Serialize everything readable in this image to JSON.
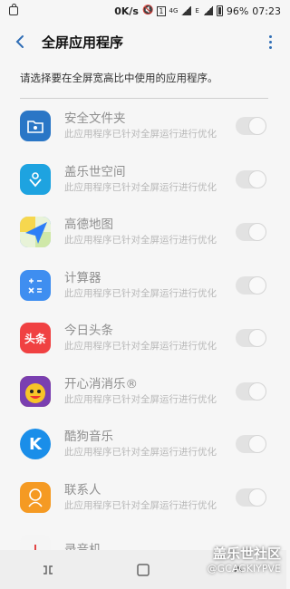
{
  "status_bar": {
    "network_speed": "0K/s",
    "network_type": "4G",
    "battery": "96%",
    "time": "07:23"
  },
  "header": {
    "title": "全屏应用程序"
  },
  "description": "请选择要在全屏宽高比中使用的应用程序。",
  "apps": [
    {
      "name": "安全文件夹",
      "subtitle": "此应用程序已针对全屏运行进行优化",
      "icon": "secure-folder-icon",
      "color": "#2a76c6"
    },
    {
      "name": "盖乐世空间",
      "subtitle": "此应用程序已针对全屏运行进行优化",
      "icon": "galaxy-space-icon",
      "color": "#1ea3e0"
    },
    {
      "name": "高德地图",
      "subtitle": "此应用程序已针对全屏运行进行优化",
      "icon": "amap-icon",
      "color": "#2d7ef7"
    },
    {
      "name": "计算器",
      "subtitle": "此应用程序已针对全屏运行进行优化",
      "icon": "calculator-icon",
      "color": "#3f8ef0"
    },
    {
      "name": "今日头条",
      "subtitle": "此应用程序已针对全屏运行进行优化",
      "icon": "toutiao-icon",
      "color": "#f04142",
      "icon_text": "头条"
    },
    {
      "name": "开心消消乐®",
      "subtitle": "此应用程序已针对全屏运行进行优化",
      "icon": "happy-elimination-icon",
      "color": "#f3c12d"
    },
    {
      "name": "酷狗音乐",
      "subtitle": "此应用程序已针对全屏运行进行优化",
      "icon": "kugou-icon",
      "color": "#1a8ee9",
      "icon_text": "K"
    },
    {
      "name": "联系人",
      "subtitle": "此应用程序已针对全屏运行进行优化",
      "icon": "contacts-icon",
      "color": "#f59a23"
    },
    {
      "name": "录音机",
      "subtitle": "",
      "icon": "recorder-icon",
      "color": "#f5f5f5"
    }
  ],
  "watermark": {
    "line1": "盖乐世社区",
    "line2": "@GCAGKIYPVE"
  }
}
